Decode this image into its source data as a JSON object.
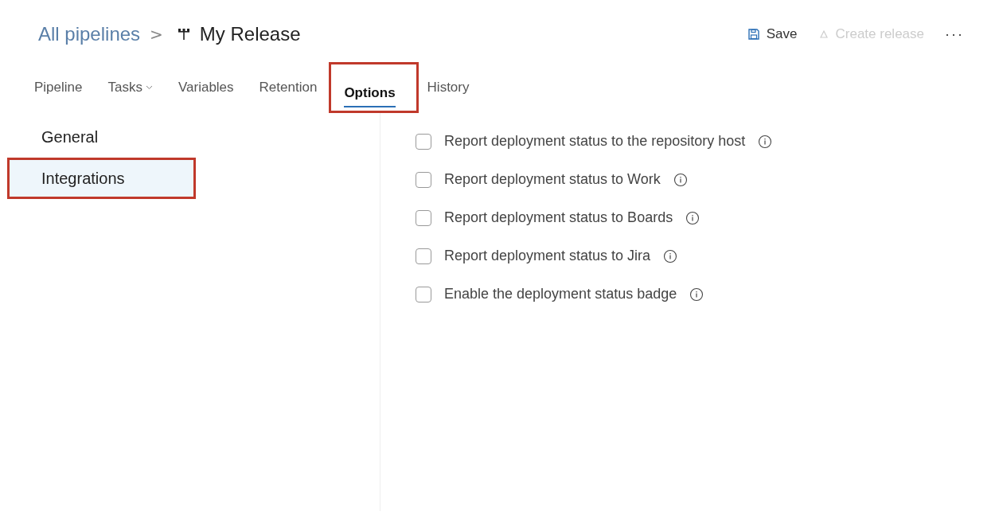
{
  "breadcrumb": {
    "parent": "All pipelines",
    "separator": ">",
    "title": "My Release"
  },
  "actions": [
    {
      "kind": "save",
      "label": "Save",
      "disabled": false
    },
    {
      "kind": "release",
      "label": "Create release",
      "disabled": true
    },
    {
      "kind": "more",
      "label": "···",
      "disabled": false
    }
  ],
  "tabs": [
    {
      "label": "Pipeline",
      "selected": false,
      "dropdown": false,
      "highlighted": false
    },
    {
      "label": "Tasks",
      "selected": false,
      "dropdown": true,
      "highlighted": false
    },
    {
      "label": "Variables",
      "selected": false,
      "dropdown": false,
      "highlighted": false
    },
    {
      "label": "Retention",
      "selected": false,
      "dropdown": false,
      "highlighted": false
    },
    {
      "label": "Options",
      "selected": true,
      "dropdown": false,
      "highlighted": true
    },
    {
      "label": "History",
      "selected": false,
      "dropdown": false,
      "highlighted": false
    }
  ],
  "sidebar": {
    "items": [
      {
        "label": "General",
        "selected": false,
        "highlighted": false
      },
      {
        "label": "Integrations",
        "selected": true,
        "highlighted": true
      }
    ]
  },
  "options": [
    {
      "label": "Report deployment status to the repository host",
      "checked": false
    },
    {
      "label": "Report deployment status to Work",
      "checked": false
    },
    {
      "label": "Report deployment status to Boards",
      "checked": false
    },
    {
      "label": "Report deployment status to Jira",
      "checked": false
    },
    {
      "label": "Enable the deployment status badge",
      "checked": false
    }
  ]
}
